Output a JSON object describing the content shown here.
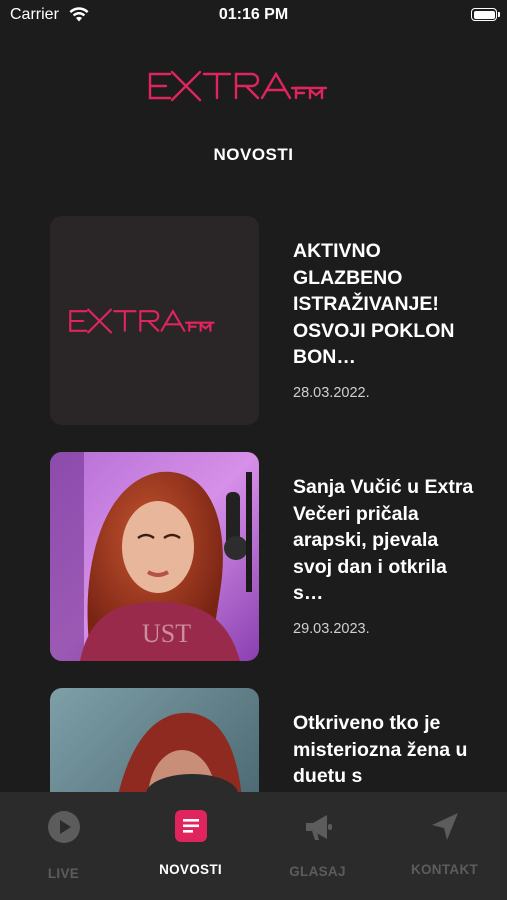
{
  "status_bar": {
    "carrier": "Carrier",
    "time": "01:16 PM",
    "battery_level": 1.0
  },
  "brand": {
    "name": "EXTRA",
    "suffix": "FM",
    "accent_color": "#e0245e"
  },
  "header": {
    "title": "NOVOSTI"
  },
  "news": [
    {
      "headline": "AKTIVNO GLAZBENO ISTRAŽIVANJE! OSVOJI POKLON BON…",
      "date": "28.03.2022.",
      "image": "extra-fm-logo"
    },
    {
      "headline": "Sanja Vučić u Extra Večeri pričala arapski, pjevala svoj dan i otkrila s…",
      "date": "29.03.2023.",
      "image": "woman-with-microphone-photo"
    },
    {
      "headline": "Otkriveno tko je misteriozna žena u duetu s",
      "date": "",
      "image": "red-haired-woman-photo"
    }
  ],
  "tab_bar": {
    "tabs": [
      {
        "label": "LIVE",
        "icon": "play-icon",
        "active": false
      },
      {
        "label": "NOVOSTI",
        "icon": "news-icon",
        "active": true
      },
      {
        "label": "GLASAJ",
        "icon": "megaphone-icon",
        "active": false
      },
      {
        "label": "KONTAKT",
        "icon": "location-arrow-icon",
        "active": false
      }
    ]
  }
}
